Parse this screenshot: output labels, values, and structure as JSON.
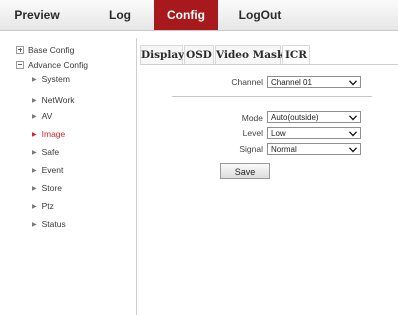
{
  "nav": {
    "items": [
      {
        "label": "Preview"
      },
      {
        "label": "Log"
      },
      {
        "label": "Config"
      },
      {
        "label": "LogOut"
      }
    ],
    "active_color": "#a8191e"
  },
  "sidebar": {
    "base_config": "Base Config",
    "advance_config": "Advance Config",
    "items": [
      {
        "label": "System"
      },
      {
        "label": "NetWork"
      },
      {
        "label": "AV"
      },
      {
        "label": "Image"
      },
      {
        "label": "Safe"
      },
      {
        "label": "Event"
      },
      {
        "label": "Store"
      },
      {
        "label": "Ptz"
      },
      {
        "label": "Status"
      }
    ],
    "active_item": "Image",
    "active_color": "#d8232a"
  },
  "tabs": [
    {
      "label": "Display"
    },
    {
      "label": "OSD"
    },
    {
      "label": "Video Mask"
    },
    {
      "label": "ICR"
    }
  ],
  "active_tab": "ICR",
  "form": {
    "channel": {
      "label": "Channel",
      "value": "Channel 01"
    },
    "mode": {
      "label": "Mode",
      "value": "Auto(outside)"
    },
    "level": {
      "label": "Level",
      "value": "Low"
    },
    "signal": {
      "label": "Signal",
      "value": "Normal"
    },
    "save_label": "Save"
  }
}
